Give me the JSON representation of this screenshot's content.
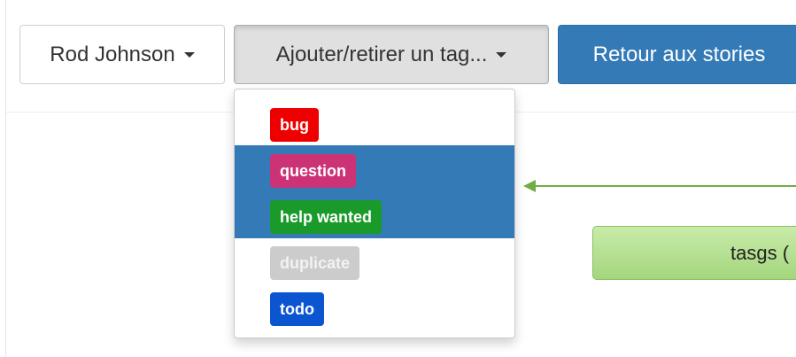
{
  "toolbar": {
    "user_label": "Rod Johnson",
    "tag_dropdown_label": "Ajouter/retirer un tag...",
    "back_label": "Retour aux stories"
  },
  "tag_menu": {
    "items": [
      {
        "label": "bug",
        "color": "#ee0000",
        "selected": false
      },
      {
        "label": "question",
        "color": "#cc3377",
        "selected": true
      },
      {
        "label": "help wanted",
        "color": "#1a9a2a",
        "selected": true
      },
      {
        "label": "duplicate",
        "color": "#cccccc",
        "selected": false
      },
      {
        "label": "todo",
        "color": "#0b55d0",
        "selected": false
      }
    ],
    "highlight_color": "#337ab7"
  },
  "annotation": {
    "callout_text": "tasgs (",
    "arrow_color": "#70ad47",
    "callout_color": "#a4d67d"
  },
  "colors": {
    "primary": "#337ab7"
  }
}
